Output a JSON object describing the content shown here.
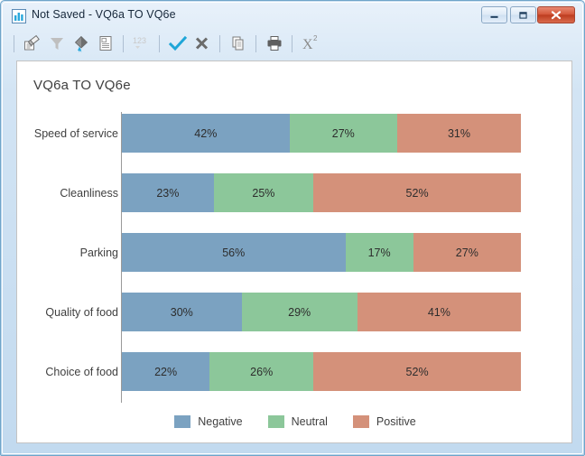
{
  "window": {
    "title": "Not Saved - VQ6a TO VQ6e",
    "icon": "bar-chart-icon",
    "controls": {
      "minimize": "minimize-icon",
      "maximize": "maximize-icon",
      "close": "close-icon"
    }
  },
  "toolbar": {
    "groups": [
      {
        "buttons": [
          {
            "name": "edit-chart-icon",
            "tooltip": "Edit",
            "disabled": false
          },
          {
            "name": "filter-icon",
            "tooltip": "Filter",
            "disabled": false
          },
          {
            "name": "fill-color-icon",
            "tooltip": "Fill Color",
            "disabled": false
          },
          {
            "name": "table-view-icon",
            "tooltip": "Table View",
            "disabled": false
          }
        ]
      },
      {
        "buttons": [
          {
            "name": "numbers-icon",
            "tooltip": "123",
            "label": "123",
            "disabled": true
          }
        ]
      },
      {
        "buttons": [
          {
            "name": "accept-check-icon",
            "tooltip": "Accept",
            "disabled": false
          },
          {
            "name": "cancel-x-icon",
            "tooltip": "Cancel",
            "disabled": false
          }
        ]
      },
      {
        "buttons": [
          {
            "name": "copy-icon",
            "tooltip": "Copy",
            "disabled": false
          }
        ]
      },
      {
        "buttons": [
          {
            "name": "print-icon",
            "tooltip": "Print",
            "disabled": false
          }
        ]
      },
      {
        "buttons": [
          {
            "name": "chi-square-icon",
            "tooltip": "Chi Square",
            "label": "X",
            "sup": "2",
            "disabled": false
          }
        ]
      }
    ]
  },
  "colors": {
    "negative": "#7ba2c1",
    "neutral": "#8cc79a",
    "positive": "#d4917a",
    "axis": "#9a9a9a",
    "text": "#3f3f3f",
    "panel_border": "#c3c3c3",
    "accent_check": "#1fa6d8",
    "close_button": "#c7452a"
  },
  "chart_data": {
    "type": "bar",
    "subtype": "stacked-horizontal-100pct",
    "title": "VQ6a TO VQ6e",
    "xlabel": "",
    "ylabel": "",
    "xlim": [
      0,
      100
    ],
    "grid": false,
    "legend_position": "bottom",
    "legend": [
      "Negative",
      "Neutral",
      "Positive"
    ],
    "categories": [
      "Speed of service",
      "Cleanliness",
      "Parking",
      "Quality of food",
      "Choice of food"
    ],
    "series": [
      {
        "name": "Negative",
        "color": "#7ba2c1",
        "values": [
          42,
          23,
          56,
          30,
          22
        ]
      },
      {
        "name": "Neutral",
        "color": "#8cc79a",
        "values": [
          27,
          25,
          17,
          29,
          26
        ]
      },
      {
        "name": "Positive",
        "color": "#d4917a",
        "values": [
          31,
          52,
          27,
          41,
          52
        ]
      }
    ],
    "labels": [
      [
        "42%",
        "27%",
        "31%"
      ],
      [
        "23%",
        "25%",
        "52%"
      ],
      [
        "56%",
        "17%",
        "27%"
      ],
      [
        "30%",
        "29%",
        "41%"
      ],
      [
        "22%",
        "26%",
        "52%"
      ]
    ]
  }
}
